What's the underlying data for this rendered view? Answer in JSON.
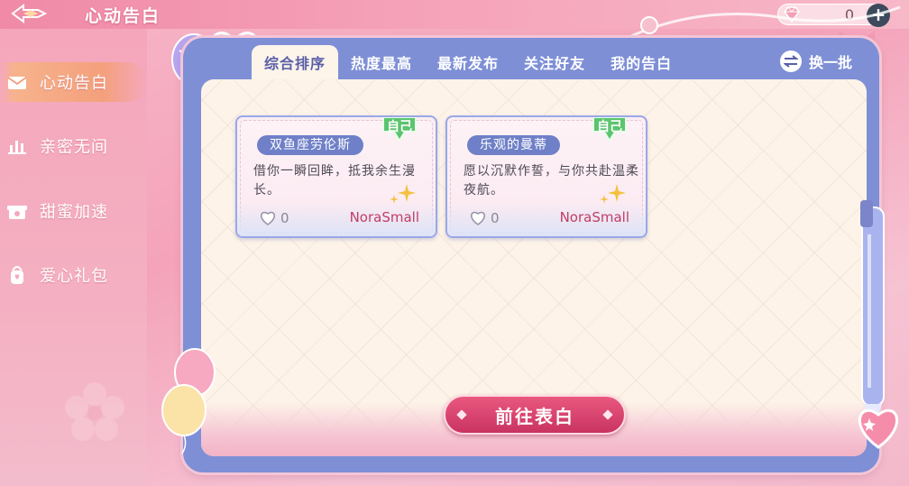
{
  "header": {
    "title": "心动告白",
    "currency_count": "0",
    "currency_icon": "gem-icon",
    "add_icon": "plus-icon"
  },
  "sidebar": {
    "items": [
      {
        "label": "心动告白",
        "icon": "envelope-icon",
        "active": true
      },
      {
        "label": "亲密无间",
        "icon": "chart-bar-icon",
        "active": false
      },
      {
        "label": "甜蜜加速",
        "icon": "gift-box-icon",
        "active": false
      },
      {
        "label": "爱心礼包",
        "icon": "bag-icon",
        "active": false
      }
    ]
  },
  "tabs": [
    {
      "label": "综合排序",
      "active": true
    },
    {
      "label": "热度最高",
      "active": false
    },
    {
      "label": "最新发布",
      "active": false
    },
    {
      "label": "关注好友",
      "active": false
    },
    {
      "label": "我的告白",
      "active": false
    }
  ],
  "refresh_label": "换一批",
  "cards": [
    {
      "title": "双鱼座劳伦斯",
      "badge": "自己",
      "message": "借你一瞬回眸，抵我余生漫长。",
      "likes": "0",
      "author": "NoraSmall"
    },
    {
      "title": "乐观的曼蒂",
      "badge": "自己",
      "message": "愿以沉默作誓，与你共赴温柔夜航。",
      "likes": "0",
      "author": "NoraSmall"
    }
  ],
  "cta_label": "前往表白",
  "colors": {
    "accent": "#c93362",
    "frame": "#7e8fd6",
    "tag": "#6f80c8",
    "badge": "#56c46a"
  }
}
